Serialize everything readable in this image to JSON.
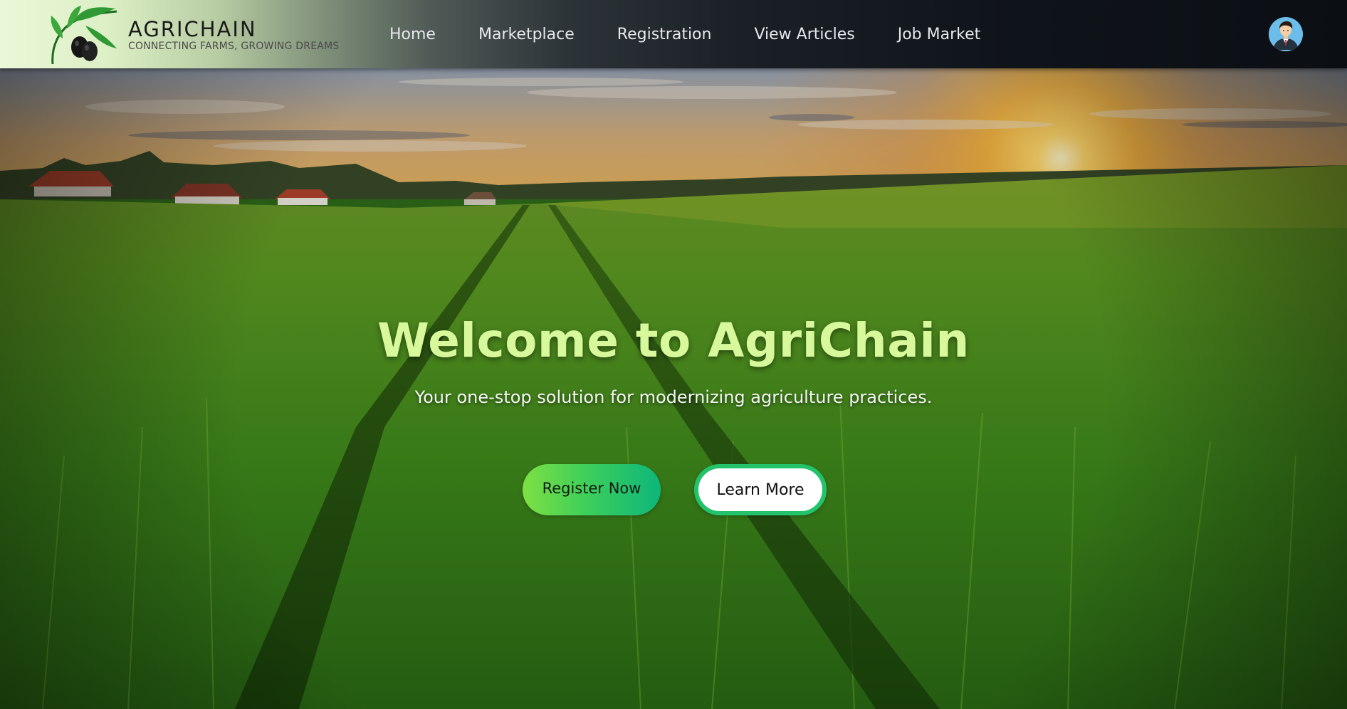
{
  "brand": {
    "name": "AGRICHAIN",
    "tagline": "CONNECTING FARMS, GROWING DREAMS"
  },
  "nav": {
    "items": [
      {
        "label": "Home"
      },
      {
        "label": "Marketplace"
      },
      {
        "label": "Registration"
      },
      {
        "label": "View Articles"
      },
      {
        "label": "Job Market"
      }
    ]
  },
  "hero": {
    "title": "Welcome to AgriChain",
    "subtitle": "Your one-stop solution for modernizing agriculture practices.",
    "primary_button": "Register Now",
    "secondary_button": "Learn More"
  },
  "icons": {
    "logo": "olive-branch-logo",
    "profile": "user-avatar-icon"
  },
  "colors": {
    "title": "#d8f89c",
    "primary_gradient_start": "#7ee043",
    "primary_gradient_end": "#0db67a",
    "secondary_border": "#22c36a",
    "nav_text": "#e6e8ea"
  }
}
